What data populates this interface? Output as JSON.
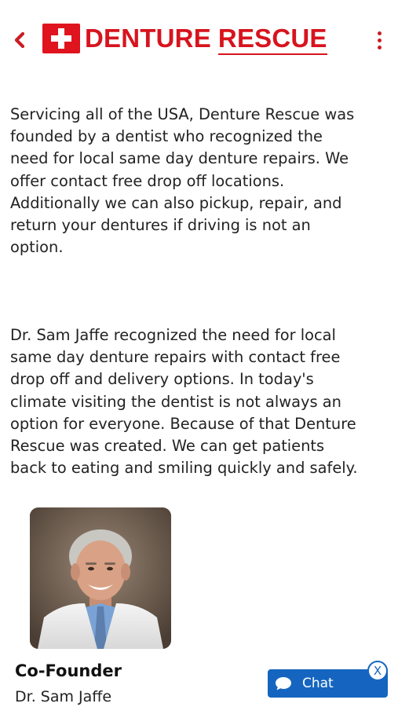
{
  "header": {
    "logo_word1": "DENTURE",
    "logo_word2": "RESCUE",
    "brand_color": "#d7141e",
    "back_icon": "chevron-left-icon",
    "menu_icon": "more-vertical-icon"
  },
  "content": {
    "paragraph1": "Servicing all of the USA, Denture Rescue was\nfounded by a dentist who recognized the\nneed for local same day denture repairs. We\noffer contact free drop off locations.\nAdditionally we can also pickup, repair, and\nreturn your dentures if driving is not an\noption.",
    "paragraph2": "Dr. Sam Jaffe recognized the need for local\nsame day denture repairs with contact free\ndrop off and delivery options.  In today's\nclimate visiting the dentist is not always an\noption for everyone.  Because of that Denture\nRescue was created.  We can get patients\nback to eating and smiling quickly and safely."
  },
  "profile": {
    "role": "Co-Founder",
    "name": "Dr. Sam Jaffe"
  },
  "chat_widget": {
    "label": "Chat",
    "close_label": "X",
    "color": "#1565c0"
  }
}
